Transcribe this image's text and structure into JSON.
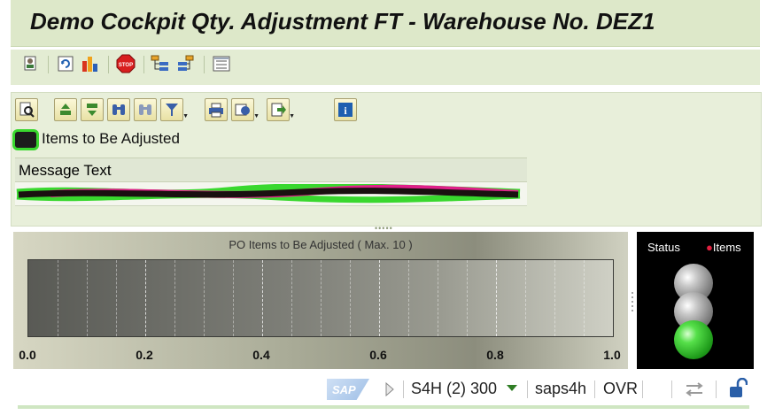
{
  "title": "Demo Cockpit Qty. Adjustment FT - Warehouse No. DEZ1",
  "app_toolbar": {
    "icons": [
      "user-settings-icon",
      "refresh-icon",
      "chart-icon",
      "stop-icon",
      "tree-expand-icon",
      "tree-collapse-icon",
      "list-icon"
    ]
  },
  "alv_toolbar": {
    "icons": [
      "details-icon",
      "sort-ascending-icon",
      "sort-descending-icon",
      "find-icon",
      "find-next-icon",
      "filter-icon",
      "print-icon",
      "views-icon",
      "export-icon",
      "info-icon"
    ]
  },
  "items_label": "Items to Be Adjusted",
  "grid": {
    "column_header": "Message Text",
    "rows": [
      ""
    ]
  },
  "gauge": {
    "title": "PO Items to Be Adjusted ( Max. 10 )",
    "ticks": [
      "0.0",
      "0.2",
      "0.4",
      "0.6",
      "0.8",
      "1.0"
    ],
    "value": 0
  },
  "status_panel": {
    "status_label": "Status",
    "items_label": "Items",
    "lights": [
      "gray",
      "gray",
      "green"
    ]
  },
  "status_bar": {
    "logo": "SAP",
    "system": "S4H (2) 300",
    "server": "saps4h",
    "mode": "OVR"
  },
  "colors": {
    "title_bg": "#dde8c9",
    "light_green": "#2fbf2b",
    "light_gray": "#9a9a9a",
    "highlight_green": "#39d82e",
    "highlight_magenta": "#e0208a"
  }
}
